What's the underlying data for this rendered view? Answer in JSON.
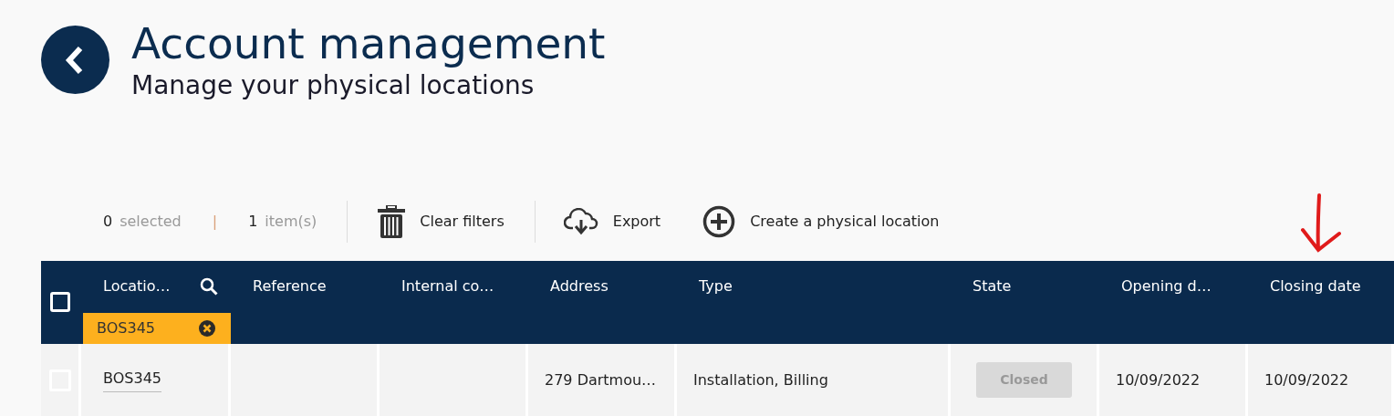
{
  "page": {
    "title": "Account management",
    "subtitle": "Manage your physical locations"
  },
  "toolbar": {
    "selected_count": "0",
    "selected_label": "selected",
    "separator": "|",
    "item_count": "1",
    "item_label": "item(s)",
    "actions": [
      {
        "kind": "trash",
        "label": "Clear filters"
      },
      {
        "kind": "export",
        "label": "Export"
      },
      {
        "kind": "create",
        "label": "Create a physical location"
      }
    ]
  },
  "table": {
    "select_all": {
      "checked": false
    },
    "columns": [
      {
        "label": "Locatio…",
        "searchable": true,
        "filter": "BOS345"
      },
      {
        "label": "Reference"
      },
      {
        "label": "Internal co…"
      },
      {
        "label": "Address"
      },
      {
        "label": "Type"
      },
      {
        "label": "State"
      },
      {
        "label": "Opening d…"
      },
      {
        "label": "Closing date"
      }
    ],
    "rows": [
      {
        "checked": false,
        "cells": [
          {
            "kind": "link",
            "text": "BOS345"
          },
          {
            "kind": "empty"
          },
          {
            "kind": "empty"
          },
          {
            "kind": "text",
            "text": "279 Dartmou…"
          },
          {
            "kind": "text",
            "text": "Installation, Billing"
          },
          {
            "kind": "badge",
            "text": "Closed"
          },
          {
            "kind": "text",
            "text": "10/09/2022"
          },
          {
            "kind": "text",
            "text": "10/09/2022"
          }
        ]
      }
    ]
  }
}
